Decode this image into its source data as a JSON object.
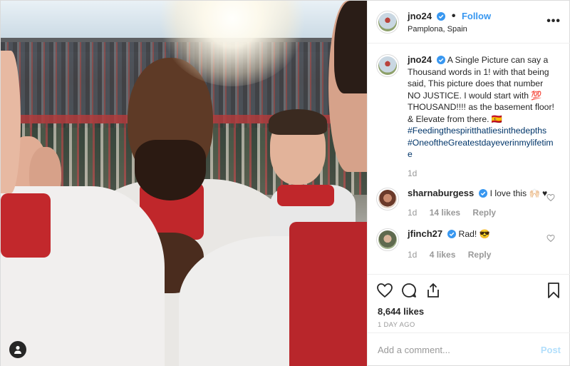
{
  "header": {
    "username": "jno24",
    "follow_label": "Follow",
    "location": "Pamplona, Spain",
    "more_label": "•••"
  },
  "caption": {
    "username": "jno24",
    "text": "A Single Picture can say a Thousand words in 1! with that being said, This picture does that number NO JUSTICE. I would start with 💯 THOUSAND!!!! as the basement floor! & Elevate from there. 🇪🇸",
    "hashtags": [
      "#Feedingthespiritthatliesinthedepths",
      "#OneoftheGreatestdayeverinmylifetime"
    ],
    "time": "1d"
  },
  "comments": [
    {
      "username": "sharnaburgess",
      "text": "I love this 🙌🏻 ♥",
      "time": "1d",
      "likes": "14 likes",
      "reply": "Reply"
    },
    {
      "username": "jfinch27",
      "text": "Rad! 😎",
      "time": "1d",
      "likes": "4 likes",
      "reply": "Reply"
    }
  ],
  "post": {
    "likes": "8,644 likes",
    "ago": "1 DAY AGO"
  },
  "add_comment": {
    "placeholder": "Add a comment...",
    "post_label": "Post"
  },
  "colors": {
    "link": "#3897f0",
    "hashtag": "#003569",
    "muted": "#999999",
    "post_disabled": "#b2dffc"
  }
}
